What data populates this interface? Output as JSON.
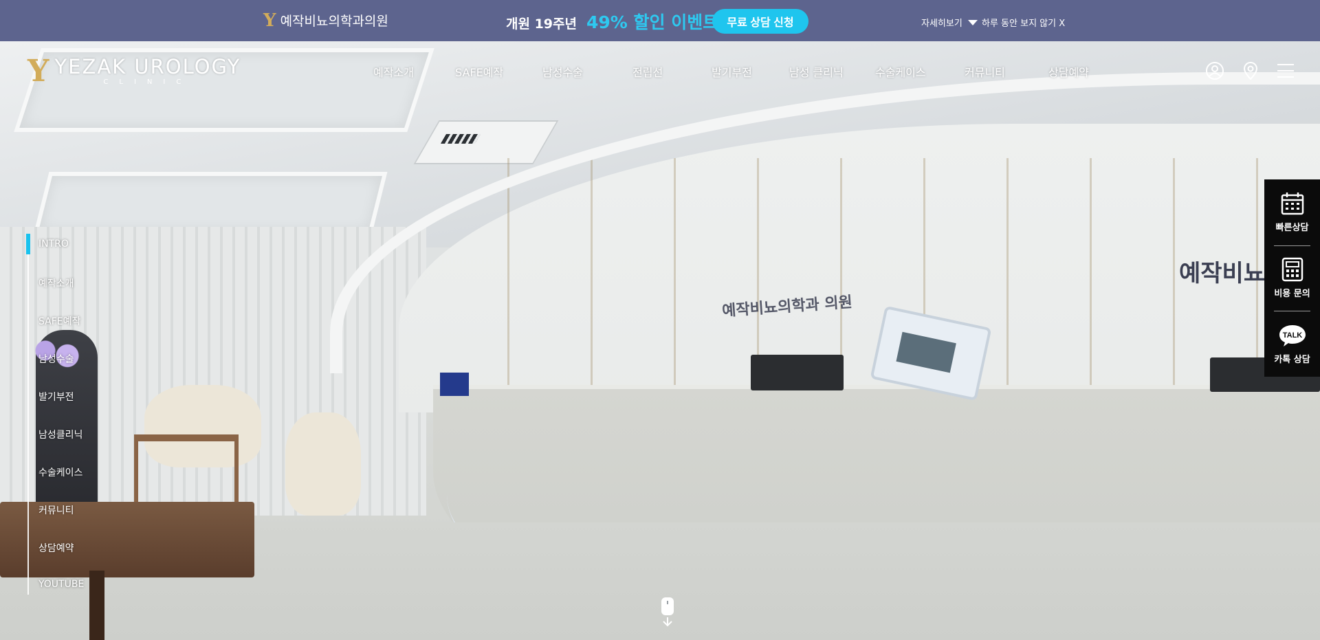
{
  "banner": {
    "clinic_name": "예작비뇨의학과의원",
    "lead_text": "개원 19주년",
    "highlight_text": "49% 할인 이벤트",
    "cta_label": "무료 상담 신청",
    "more_label": "자세히보기",
    "close_label": "하루 동안 보지 않기 X"
  },
  "header": {
    "logo_title": "YEZAK UROLOGY",
    "logo_subtitle": "CLINIC",
    "nav": [
      "예작소개",
      "SAFE예작",
      "남성수술",
      "전립선",
      "발기부전",
      "남성 클리닉",
      "수술케이스",
      "커뮤니티",
      "상담예약"
    ],
    "icons": [
      "user-icon",
      "location-pin-icon",
      "hamburger-menu-icon"
    ]
  },
  "side_nav": {
    "active_index": 0,
    "items": [
      "INTRO",
      "예작소개",
      "SAFE예작",
      "남성수술",
      "발기부전",
      "남성클리닉",
      "수술케이스",
      "커뮤니티",
      "상담예약",
      "YOUTUBE"
    ]
  },
  "quick_panel": {
    "items": [
      {
        "label": "빠른상담",
        "icon": "calendar-icon"
      },
      {
        "label": "비용 문의",
        "icon": "calculator-icon"
      },
      {
        "label": "카톡 상담",
        "icon": "talk-bubble-icon",
        "icon_text": "TALK"
      }
    ]
  },
  "hero": {
    "sign_small": "예작비뇨의학과 의원",
    "sign_large": "예작비뇨"
  },
  "colors": {
    "banner_bg": "#5d648e",
    "accent": "#1fc5ee",
    "gold": "#d2ac5a",
    "quick_panel_bg": "#0b0b0b"
  }
}
